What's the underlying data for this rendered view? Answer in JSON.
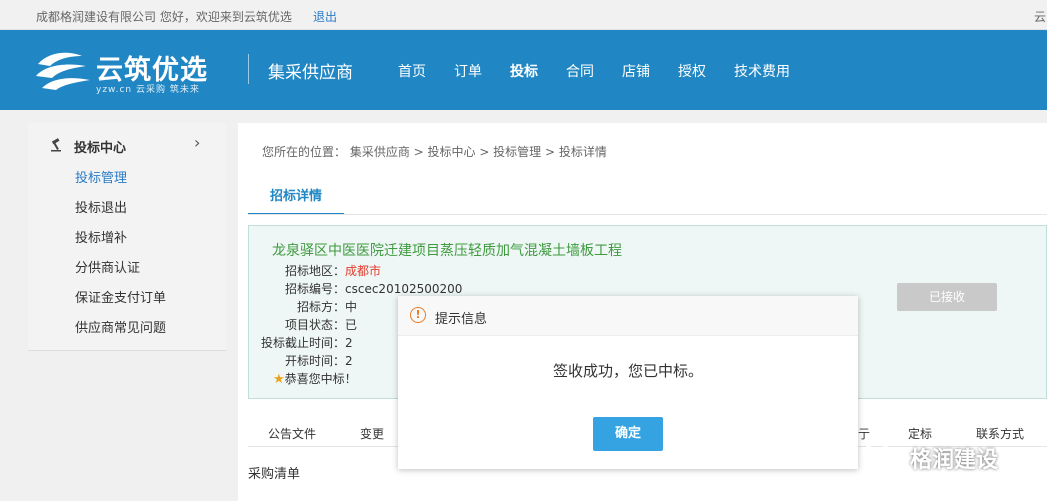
{
  "topbar": {
    "welcome": "成都格润建设有限公司 您好，欢迎来到云筑优选",
    "logout": "退出",
    "right_cut": "云"
  },
  "header": {
    "logo_text": "云筑优选",
    "logo_sub": "yzw.cn 云采购 筑未来",
    "section_title": "集采供应商",
    "nav": [
      "首页",
      "订单",
      "投标",
      "合同",
      "店铺",
      "授权",
      "技术费用"
    ],
    "nav_active": "投标"
  },
  "sidebar": {
    "head": "投标中心",
    "items": [
      {
        "label": "投标管理",
        "active": true
      },
      {
        "label": "投标退出",
        "active": false
      },
      {
        "label": "投标增补",
        "active": false
      },
      {
        "label": "分供商认证",
        "active": false
      },
      {
        "label": "保证金支付订单",
        "active": false
      },
      {
        "label": "供应商常见问题",
        "active": false
      }
    ]
  },
  "main": {
    "breadcrumb": "您所在的位置： 集采供应商 > 投标中心 > 投标管理 > 投标详情",
    "tab": "招标详情",
    "project_title": "龙泉驿区中医医院迁建项目蒸压轻质加气混凝土墙板工程",
    "rows": [
      {
        "label": "招标地区：",
        "value": "成都市",
        "red": true
      },
      {
        "label": "招标编号：",
        "value": "cscec20102500200",
        "red": false
      },
      {
        "label": "招标方：",
        "value": "中",
        "red": false
      },
      {
        "label": "项目状态：",
        "value": "已",
        "red": false
      },
      {
        "label": "投标截止时间：",
        "value": "2",
        "red": false
      },
      {
        "label": "开标时间：",
        "value": "2",
        "red": false
      }
    ],
    "congrats": "恭喜您中标！",
    "accepted_button": "已接收",
    "tabs": [
      {
        "label": "公告文件"
      },
      {
        "label": "变更"
      },
      {
        "label": "定标"
      },
      {
        "label": "联系方式"
      },
      {
        "label": "亍"
      }
    ],
    "purchase_list": "采购清单"
  },
  "dialog": {
    "title": "提示信息",
    "message": "签收成功，您已中标。",
    "ok": "确定"
  },
  "watermark": {
    "text": "格润建设"
  }
}
